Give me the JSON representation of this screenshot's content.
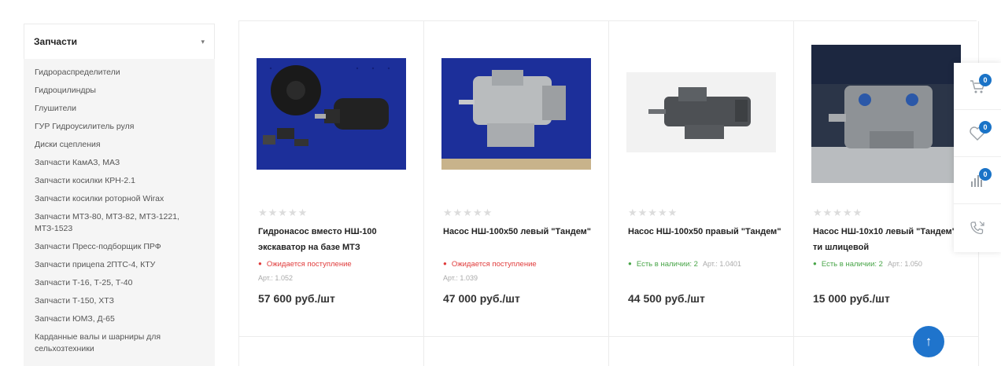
{
  "sidebar": {
    "title": "Запчасти",
    "items": [
      "Гидрораспределители",
      "Гидроцилиндры",
      "Глушители",
      "ГУР Гидроусилитель руля",
      "Диски сцепления",
      "Запчасти КамАЗ, МАЗ",
      "Запчасти косилки КРН-2.1",
      "Запчасти косилки роторной Wirax",
      "Запчасти МТЗ-80, МТЗ-82, МТЗ-1221, МТЗ-1523",
      "Запчасти Пресс-подборщик ПРФ",
      "Запчасти прицепа 2ПТС-4, КТУ",
      "Запчасти Т-16, Т-25, Т-40",
      "Запчасти Т-150, ХТЗ",
      "Запчасти ЮМЗ, Д-65",
      "Карданные валы и шарниры для сельхозтехники"
    ]
  },
  "products": [
    {
      "title": "Гидронасос вместо НШ-100 экскаватор на базе МТЗ",
      "rating": "★★★★★",
      "status": "Ожидается поступление",
      "sku": "Арт.: 1.052",
      "price": "57 600 руб./шт"
    },
    {
      "title": "Насос НШ-100х50 левый \"Тандем\"",
      "rating": "★★★★★",
      "status": "Ожидается поступление",
      "sku": "Арт.: 1.039",
      "price": "47 000 руб./шт"
    },
    {
      "title": "Насос НШ-100х50 правый \"Тандем\"",
      "rating": "★★★★★",
      "status": "Есть в наличии: 2",
      "sku": "Арт.: 1.0401",
      "price": "44 500 руб./шт"
    },
    {
      "title": "Насос НШ-10х10 левый \"Тандем\" 6-ти шлицевой",
      "rating": "★★★★★",
      "status": "Есть в наличии: 2",
      "sku": "Арт.: 1.050",
      "price": "15 000 руб./шт"
    }
  ],
  "side_panel": {
    "cart_count": "0",
    "wishlist_count": "0",
    "compare_count": "0"
  },
  "colors": {
    "accent": "#1f74cc",
    "out_of_stock": "#e03b3b",
    "in_stock": "#48a548"
  }
}
